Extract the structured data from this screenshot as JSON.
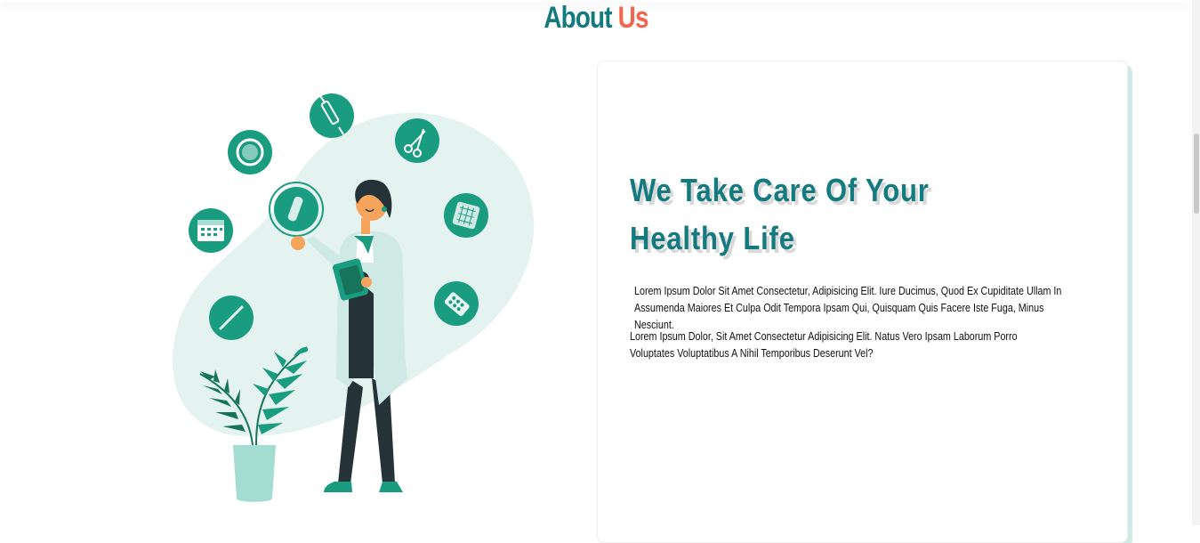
{
  "section": {
    "heading_part1": "About",
    "heading_part2": "Us"
  },
  "card": {
    "title": "We Take Care Of Your Healthy Life",
    "paragraph1": "Lorem Ipsum Dolor Sit Amet Consectetur, Adipisicing Elit. Iure Ducimus, Quod Ex Cupiditate Ullam In Assumenda Maiores Et Culpa Odit Tempora Ipsam Qui, Quisquam Quis Facere Iste Fuga, Minus Nesciunt.",
    "paragraph2": "Lorem Ipsum Dolor, Sit Amet Consectetur Adipisicing Elit. Natus Vero Ipsam Laborum Porro Voluptates Voluptatibus A Nihil Temporibus Deserunt Vel?"
  },
  "colors": {
    "accent_teal": "#137a7f",
    "accent_orange": "#f2664e",
    "icon_green": "#1a9c80",
    "blob": "#e4f3f0"
  },
  "illustration": {
    "icons": [
      "syringe-icon",
      "petri-dish-icon",
      "scissors-icon",
      "calendar-icon",
      "test-tube-icon",
      "tablet-icon",
      "pills-icon",
      "thermometer-icon"
    ]
  }
}
